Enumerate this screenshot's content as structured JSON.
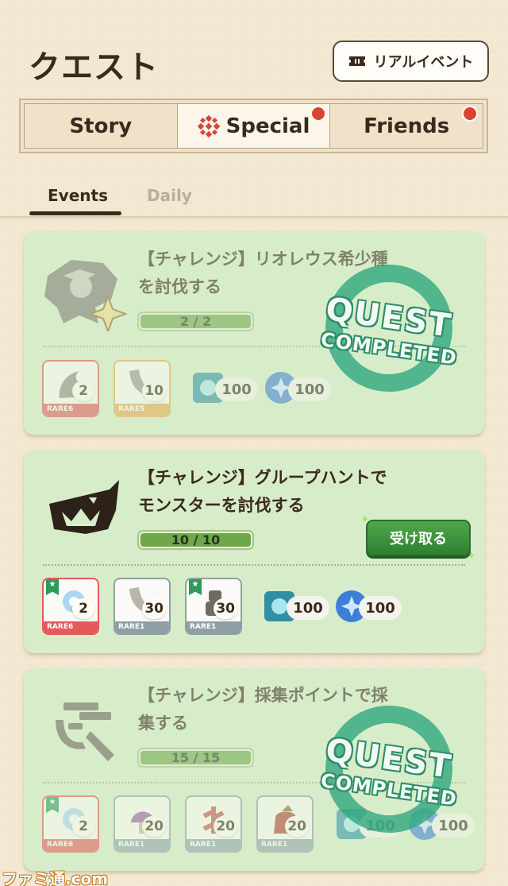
{
  "header": {
    "title": "クエスト",
    "event_button_label": "リアルイベント"
  },
  "tabs": [
    {
      "label": "Story",
      "active": false,
      "badge": false
    },
    {
      "label": "Special",
      "active": true,
      "badge": true
    },
    {
      "label": "Friends",
      "active": false,
      "badge": true
    }
  ],
  "subtabs": [
    {
      "label": "Events",
      "active": true
    },
    {
      "label": "Daily",
      "active": false
    }
  ],
  "quests": [
    {
      "title_line1": "【チャレンジ】リオレウス希少種",
      "title_line2": "を討伐する",
      "progress_text": "2 / 2",
      "progress_fraction": 1.0,
      "status": "completed",
      "stamp_line1": "QUEST",
      "stamp_line2": "COMPLETED",
      "rewards": [
        {
          "icon": "claw-material-icon",
          "count": "2",
          "rarity": "RARE6",
          "rarity_color": "#e35a5a"
        },
        {
          "icon": "horn-material-icon",
          "count": "10",
          "rarity": "RARE5",
          "rarity_color": "#e6a951"
        }
      ],
      "currencies": [
        {
          "icon": "gem-crystal-icon",
          "amount": "100"
        },
        {
          "icon": "blue-orb-icon",
          "amount": "100"
        }
      ]
    },
    {
      "title_line1": "【チャレンジ】グループハントで",
      "title_line2": "モンスターを討伐する",
      "progress_text": "10 / 10",
      "progress_fraction": 1.0,
      "status": "claimable",
      "claim_label": "受け取る",
      "rewards": [
        {
          "icon": "ice-crystal-material-icon",
          "count": "2",
          "rarity": "RARE6",
          "rarity_color": "#e35a5a",
          "flag": true
        },
        {
          "icon": "horn-material-icon",
          "count": "30",
          "rarity": "RARE1",
          "rarity_color": "#8ea0a6"
        },
        {
          "icon": "stone-figure-material-icon",
          "count": "30",
          "rarity": "RARE1",
          "rarity_color": "#8ea0a6",
          "flag": true
        }
      ],
      "currencies": [
        {
          "icon": "gem-crystal-icon",
          "amount": "100"
        },
        {
          "icon": "blue-orb-icon",
          "amount": "100"
        }
      ]
    },
    {
      "title_line1": "【チャレンジ】採集ポイントで採",
      "title_line2": "集する",
      "progress_text": "15 / 15",
      "progress_fraction": 1.0,
      "status": "completed",
      "stamp_line1": "QUEST",
      "stamp_line2": "COMPLETED",
      "rewards": [
        {
          "icon": "ice-crystal-material-icon",
          "count": "2",
          "rarity": "RARE6",
          "rarity_color": "#e35a5a",
          "flag": true
        },
        {
          "icon": "mushroom-material-icon",
          "count": "20",
          "rarity": "RARE1",
          "rarity_color": "#8ea0a6"
        },
        {
          "icon": "herb-material-icon",
          "count": "20",
          "rarity": "RARE1",
          "rarity_color": "#8ea0a6"
        },
        {
          "icon": "bag-material-icon",
          "count": "20",
          "rarity": "RARE1",
          "rarity_color": "#8ea0a6"
        }
      ],
      "currencies": [
        {
          "icon": "gem-crystal-icon",
          "amount": "100"
        },
        {
          "icon": "blue-orb-icon",
          "amount": "100"
        }
      ]
    }
  ],
  "watermark": "ファミ通.com"
}
